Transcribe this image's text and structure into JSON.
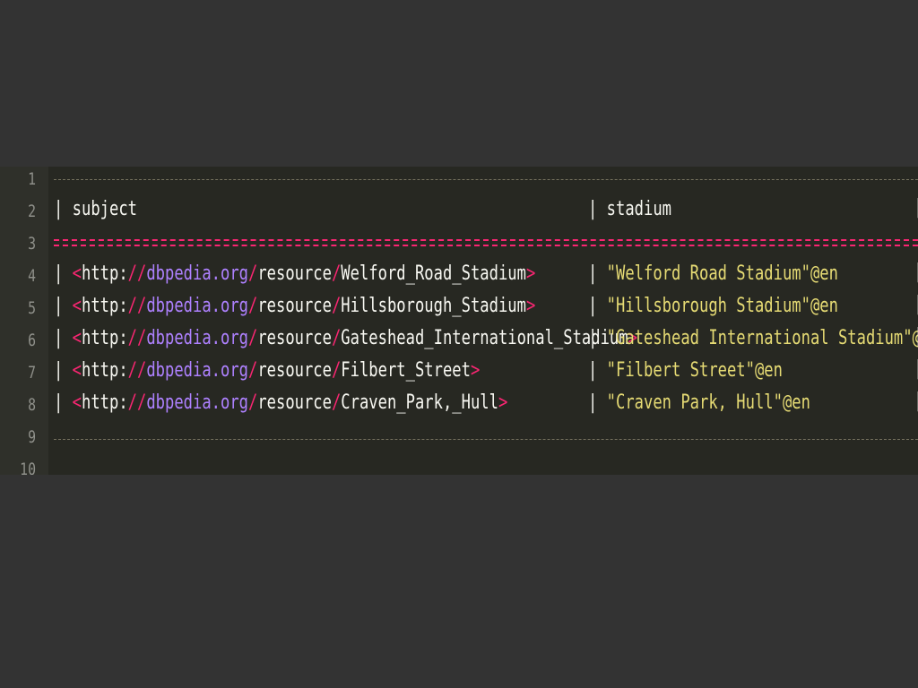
{
  "editor": {
    "line_numbers": [
      "1",
      "2",
      "3",
      "4",
      "5",
      "6",
      "7",
      "8",
      "9",
      "10"
    ],
    "header": {
      "subject_label": "subject",
      "stadium_label": "stadium",
      "pipe": "|"
    },
    "rows": [
      {
        "open": "<",
        "scheme": "http:",
        "sep1": "//",
        "domain": "dbpedia.org",
        "sep2": "/",
        "path": "resource",
        "sep3": "/",
        "name": "Welford_Road_Stadium",
        "close": ">",
        "stadium": "\"Welford Road Stadium\"@en"
      },
      {
        "open": "<",
        "scheme": "http:",
        "sep1": "//",
        "domain": "dbpedia.org",
        "sep2": "/",
        "path": "resource",
        "sep3": "/",
        "name": "Hillsborough_Stadium",
        "close": ">",
        "stadium": "\"Hillsborough Stadium\"@en"
      },
      {
        "open": "<",
        "scheme": "http:",
        "sep1": "//",
        "domain": "dbpedia.org",
        "sep2": "/",
        "path": "resource",
        "sep3": "/",
        "name": "Gateshead_International_Stadium",
        "close": ">",
        "stadium": "\"Gateshead International Stadium\"@en"
      },
      {
        "open": "<",
        "scheme": "http:",
        "sep1": "//",
        "domain": "dbpedia.org",
        "sep2": "/",
        "path": "resource",
        "sep3": "/",
        "name": "Filbert_Street",
        "close": ">",
        "stadium": "\"Filbert Street\"@en"
      },
      {
        "open": "<",
        "scheme": "http:",
        "sep1": "//",
        "domain": "dbpedia.org",
        "sep2": "/",
        "path": "resource",
        "sep3": "/",
        "name": "Craven_Park,_Hull",
        "close": ">",
        "stadium": "\"Craven Park, Hull\"@en"
      }
    ]
  }
}
